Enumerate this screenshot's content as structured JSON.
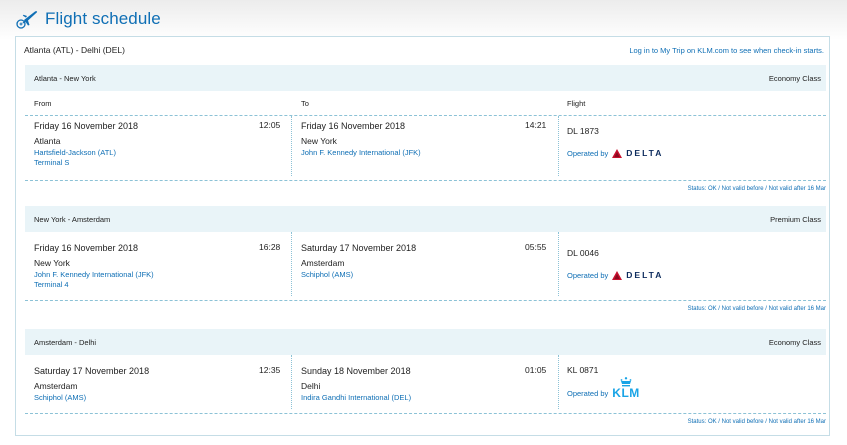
{
  "header": {
    "title": "Flight schedule",
    "icon": "plane-departure-icon"
  },
  "trip": {
    "route": "Atlanta (ATL) - Delhi (DEL)",
    "checkin_link": "Log in to My Trip on KLM.com to see when check-in starts."
  },
  "columns": {
    "from": "From",
    "to": "To",
    "flight": "Flight"
  },
  "segments": [
    {
      "title": "Atlanta - New York",
      "cabin": "Economy Class",
      "from": {
        "date": "Friday 16 November 2018",
        "time": "12:05",
        "city": "Atlanta",
        "airport": "Hartsfield-Jackson (ATL)",
        "terminal": "Terminal S"
      },
      "to": {
        "date": "Friday 16 November 2018",
        "time": "14:21",
        "city": "New York",
        "airport": "John F. Kennedy International (JFK)"
      },
      "flight": {
        "number": "DL 1873",
        "operated_by": "Operated by",
        "carrier": "DELTA"
      },
      "status": "Status: OK / Not valid before / Not valid after 16 Mar"
    },
    {
      "title": "New York - Amsterdam",
      "cabin": "Premium Class",
      "from": {
        "date": "Friday 16 November 2018",
        "time": "16:28",
        "city": "New York",
        "airport": "John F. Kennedy International (JFK)",
        "terminal": "Terminal 4"
      },
      "to": {
        "date": "Saturday 17 November 2018",
        "time": "05:55",
        "city": "Amsterdam",
        "airport": "Schiphol (AMS)"
      },
      "flight": {
        "number": "DL 0046",
        "operated_by": "Operated by",
        "carrier": "DELTA"
      },
      "status": "Status: OK / Not valid before / Not valid after 16 Mar"
    },
    {
      "title": "Amsterdam - Delhi",
      "cabin": "Economy Class",
      "from": {
        "date": "Saturday 17 November 2018",
        "time": "12:35",
        "city": "Amsterdam",
        "airport": "Schiphol (AMS)"
      },
      "to": {
        "date": "Sunday 18 November 2018",
        "time": "01:05",
        "city": "Delhi",
        "airport": "Indira Gandhi International (DEL)"
      },
      "flight": {
        "number": "KL 0871",
        "operated_by": "Operated by",
        "carrier": "KLM"
      },
      "status": "Status: OK / Not valid before / Not valid after 16 Mar"
    }
  ],
  "colors": {
    "accent": "#0f6fb5",
    "segment_bg": "#e9f4f8",
    "delta_red": "#c8102e",
    "delta_navy": "#0b2a5c",
    "klm_blue": "#19a4e6"
  }
}
